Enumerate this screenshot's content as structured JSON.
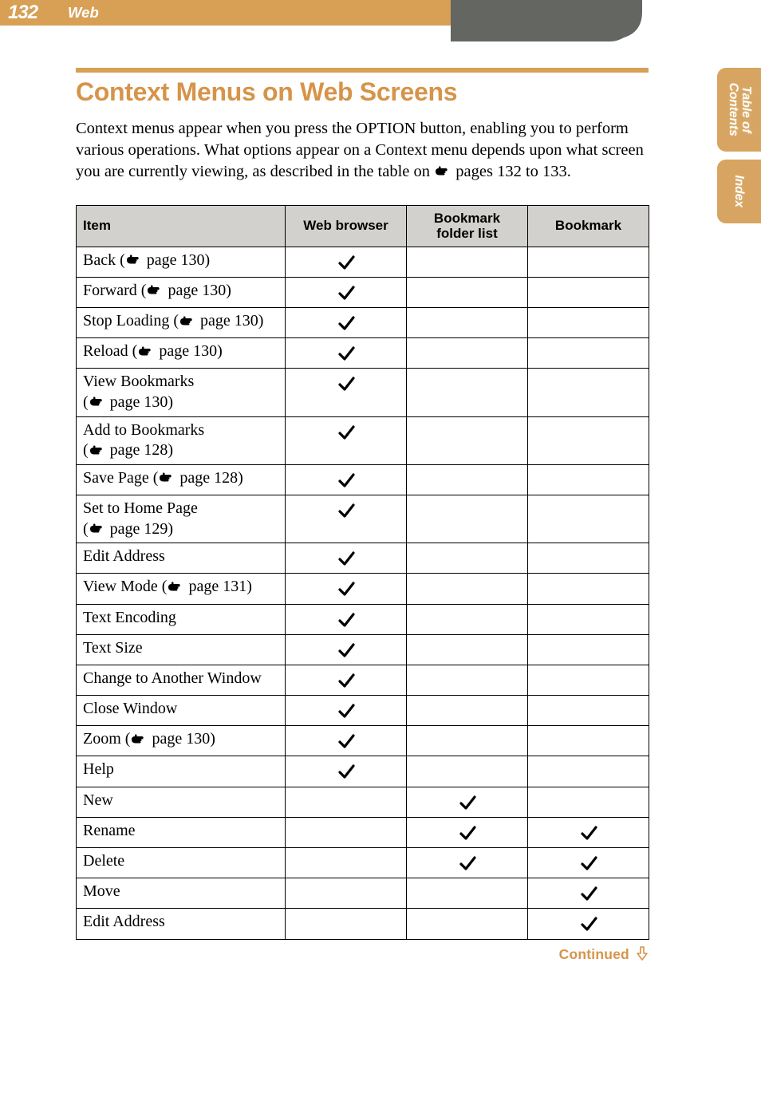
{
  "header": {
    "page_number": "132",
    "section": "Web"
  },
  "side_tabs": {
    "toc_line1": "Table of",
    "toc_line2": "Contents",
    "index": "Index"
  },
  "title": "Context Menus on Web Screens",
  "intro_parts": {
    "p1": "Context menus appear when you press the OPTION button, enabling you to perform various operations. What options appear on a Context menu depends upon what screen you are currently viewing, as described in the table on ",
    "p2": " pages 132 to 133."
  },
  "table": {
    "headers": {
      "item": "Item",
      "web_browser": "Web browser",
      "bookmark_folder_list": "Bookmark folder list",
      "bookmark": "Bookmark"
    }
  },
  "rows": [
    {
      "label_pre": "Back (",
      "label_post": " page 130)",
      "cols": [
        true,
        false,
        false
      ]
    },
    {
      "label_pre": "Forward (",
      "label_post": " page 130)",
      "cols": [
        true,
        false,
        false
      ]
    },
    {
      "label_pre": "Stop Loading (",
      "label_post": " page 130)",
      "cols": [
        true,
        false,
        false
      ]
    },
    {
      "label_pre": "Reload (",
      "label_post": " page 130)",
      "cols": [
        true,
        false,
        false
      ]
    },
    {
      "label_pre": "View Bookmarks\n(",
      "label_post": " page 130)",
      "multiline": true,
      "cols": [
        true,
        false,
        false
      ]
    },
    {
      "label_pre": "Add to Bookmarks\n(",
      "label_post": " page 128)",
      "multiline": true,
      "cols": [
        true,
        false,
        false
      ]
    },
    {
      "label_pre": "Save Page (",
      "label_post": " page 128)",
      "cols": [
        true,
        false,
        false
      ]
    },
    {
      "label_pre": "Set to Home Page\n(",
      "label_post": " page 129)",
      "multiline": true,
      "cols": [
        true,
        false,
        false
      ]
    },
    {
      "label_pre": "Edit Address",
      "label_post": "",
      "no_ref": true,
      "cols": [
        true,
        false,
        false
      ]
    },
    {
      "label_pre": "View Mode (",
      "label_post": " page 131)",
      "cols": [
        true,
        false,
        false
      ]
    },
    {
      "label_pre": "Text Encoding",
      "label_post": "",
      "no_ref": true,
      "cols": [
        true,
        false,
        false
      ]
    },
    {
      "label_pre": "Text Size",
      "label_post": "",
      "no_ref": true,
      "cols": [
        true,
        false,
        false
      ]
    },
    {
      "label_pre": "Change to Another Window",
      "label_post": "",
      "no_ref": true,
      "cols": [
        true,
        false,
        false
      ]
    },
    {
      "label_pre": "Close Window",
      "label_post": "",
      "no_ref": true,
      "cols": [
        true,
        false,
        false
      ]
    },
    {
      "label_pre": "Zoom (",
      "label_post": " page 130)",
      "cols": [
        true,
        false,
        false
      ]
    },
    {
      "label_pre": "Help",
      "label_post": "",
      "no_ref": true,
      "cols": [
        true,
        false,
        false
      ]
    },
    {
      "label_pre": "New",
      "label_post": "",
      "no_ref": true,
      "cols": [
        false,
        true,
        false
      ]
    },
    {
      "label_pre": "Rename",
      "label_post": "",
      "no_ref": true,
      "cols": [
        false,
        true,
        true
      ]
    },
    {
      "label_pre": "Delete",
      "label_post": "",
      "no_ref": true,
      "cols": [
        false,
        true,
        true
      ]
    },
    {
      "label_pre": "Move",
      "label_post": "",
      "no_ref": true,
      "cols": [
        false,
        false,
        true
      ]
    },
    {
      "label_pre": "Edit Address",
      "label_post": "",
      "no_ref": true,
      "cols": [
        false,
        false,
        true
      ]
    }
  ],
  "continued": "Continued",
  "chart_data": {
    "type": "table",
    "title": "Context Menus on Web Screens",
    "columns": [
      "Item",
      "Web browser",
      "Bookmark folder list",
      "Bookmark"
    ],
    "rows": [
      [
        "Back (page 130)",
        "✓",
        "",
        ""
      ],
      [
        "Forward (page 130)",
        "✓",
        "",
        ""
      ],
      [
        "Stop Loading (page 130)",
        "✓",
        "",
        ""
      ],
      [
        "Reload (page 130)",
        "✓",
        "",
        ""
      ],
      [
        "View Bookmarks (page 130)",
        "✓",
        "",
        ""
      ],
      [
        "Add to Bookmarks (page 128)",
        "✓",
        "",
        ""
      ],
      [
        "Save Page (page 128)",
        "✓",
        "",
        ""
      ],
      [
        "Set to Home Page (page 129)",
        "✓",
        "",
        ""
      ],
      [
        "Edit Address",
        "✓",
        "",
        ""
      ],
      [
        "View Mode (page 131)",
        "✓",
        "",
        ""
      ],
      [
        "Text Encoding",
        "✓",
        "",
        ""
      ],
      [
        "Text Size",
        "✓",
        "",
        ""
      ],
      [
        "Change to Another Window",
        "✓",
        "",
        ""
      ],
      [
        "Close Window",
        "✓",
        "",
        ""
      ],
      [
        "Zoom (page 130)",
        "✓",
        "",
        ""
      ],
      [
        "Help",
        "✓",
        "",
        ""
      ],
      [
        "New",
        "",
        "✓",
        ""
      ],
      [
        "Rename",
        "",
        "✓",
        "✓"
      ],
      [
        "Delete",
        "",
        "✓",
        "✓"
      ],
      [
        "Move",
        "",
        "",
        "✓"
      ],
      [
        "Edit Address",
        "",
        "",
        "✓"
      ]
    ]
  }
}
